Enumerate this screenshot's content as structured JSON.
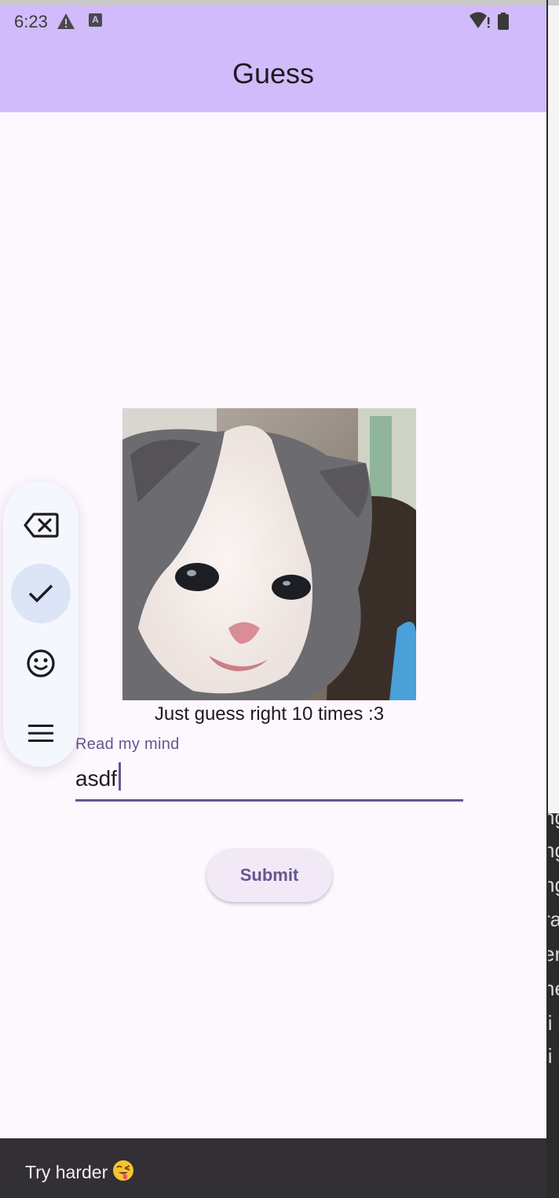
{
  "status_bar": {
    "time": "6:23",
    "keyboard_badge": "A"
  },
  "app_bar": {
    "title": "Guess"
  },
  "content": {
    "image_alt": "kitten",
    "caption": "Just guess right 10 times :3",
    "input": {
      "label": "Read my mind",
      "value": "asdf"
    },
    "submit_label": "Submit"
  },
  "floating_toolbar": {
    "items": [
      "backspace-icon",
      "check-icon",
      "emoji-icon",
      "menu-icon"
    ],
    "selected": "check-icon"
  },
  "snackbar": {
    "message": "Try harder",
    "emoji": "😜"
  },
  "side_panel_fragments": [
    "ng",
    "ng",
    "ng",
    "ra",
    "er",
    "ne",
    "li",
    "li"
  ],
  "colors": {
    "app_bar": "#d2bbfa",
    "background": "#fdf7fe",
    "accent": "#65558f",
    "snackbar": "#322f35"
  }
}
